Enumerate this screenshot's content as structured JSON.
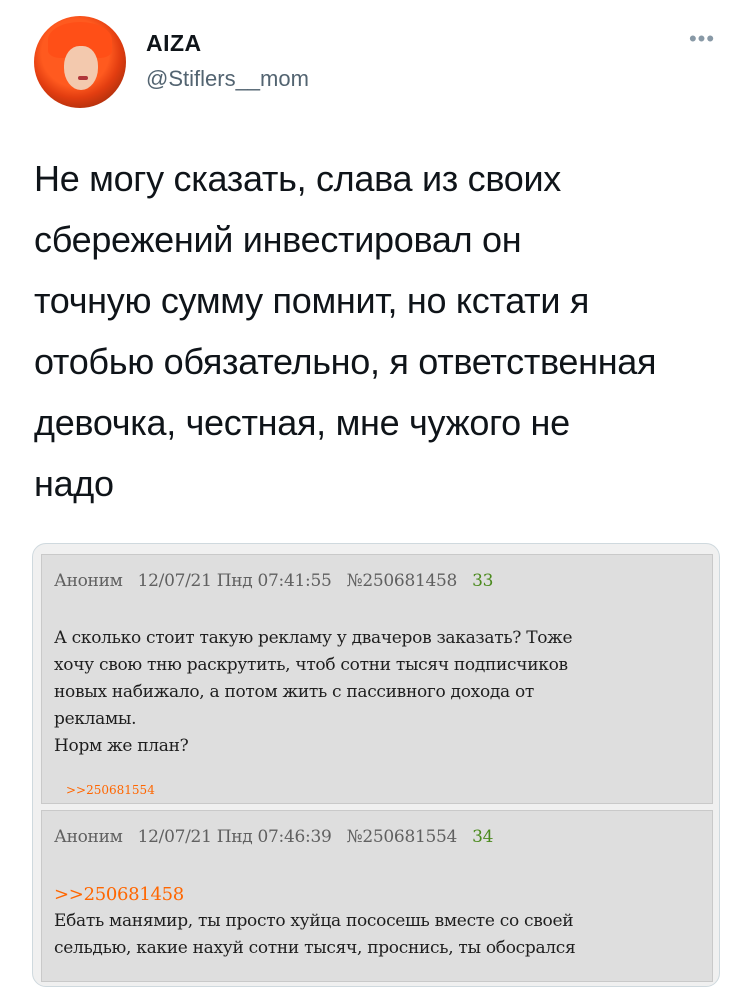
{
  "author": {
    "name": "AIZA",
    "handle": "@Stiflers__mom"
  },
  "more_icon": "more-horizontal-icon",
  "tweet": {
    "lines": [
      "Не могу сказать, слава из своих",
      "сбережений инвестировал он",
      "точную сумму помнит, но кстати я",
      "отобью обязательно, я ответственная",
      "девочка, честная, мне чужого не",
      "надо"
    ]
  },
  "posts": [
    {
      "author": "Аноним",
      "date": "12/07/21 Пнд 07:41:55",
      "number": "№250681458",
      "count": "33",
      "quote": "",
      "lines": [
        "А сколько стоит такую рекламу у двачеров заказать? Тоже",
        "хочу свою тню раскрутить, чтоб сотни тысяч подписчиков",
        "новых набижало, а потом жить с пассивного дохода от",
        "рекламы.",
        "Норм же план?"
      ],
      "reply": ">>250681554"
    },
    {
      "author": "Аноним",
      "date": "12/07/21 Пнд 07:46:39",
      "number": "№250681554",
      "count": "34",
      "quote": ">>250681458",
      "lines": [
        "Ебать манямир, ты просто хуйца пососешь вместе со своей",
        "сельдью, какие нахуй сотни тысяч, проснись, ты обосрался"
      ],
      "reply": ""
    }
  ],
  "colors": {
    "handle": "#536471",
    "post_bg": "#dedede",
    "count": "#4b8a1e",
    "link": "#ff6600"
  }
}
